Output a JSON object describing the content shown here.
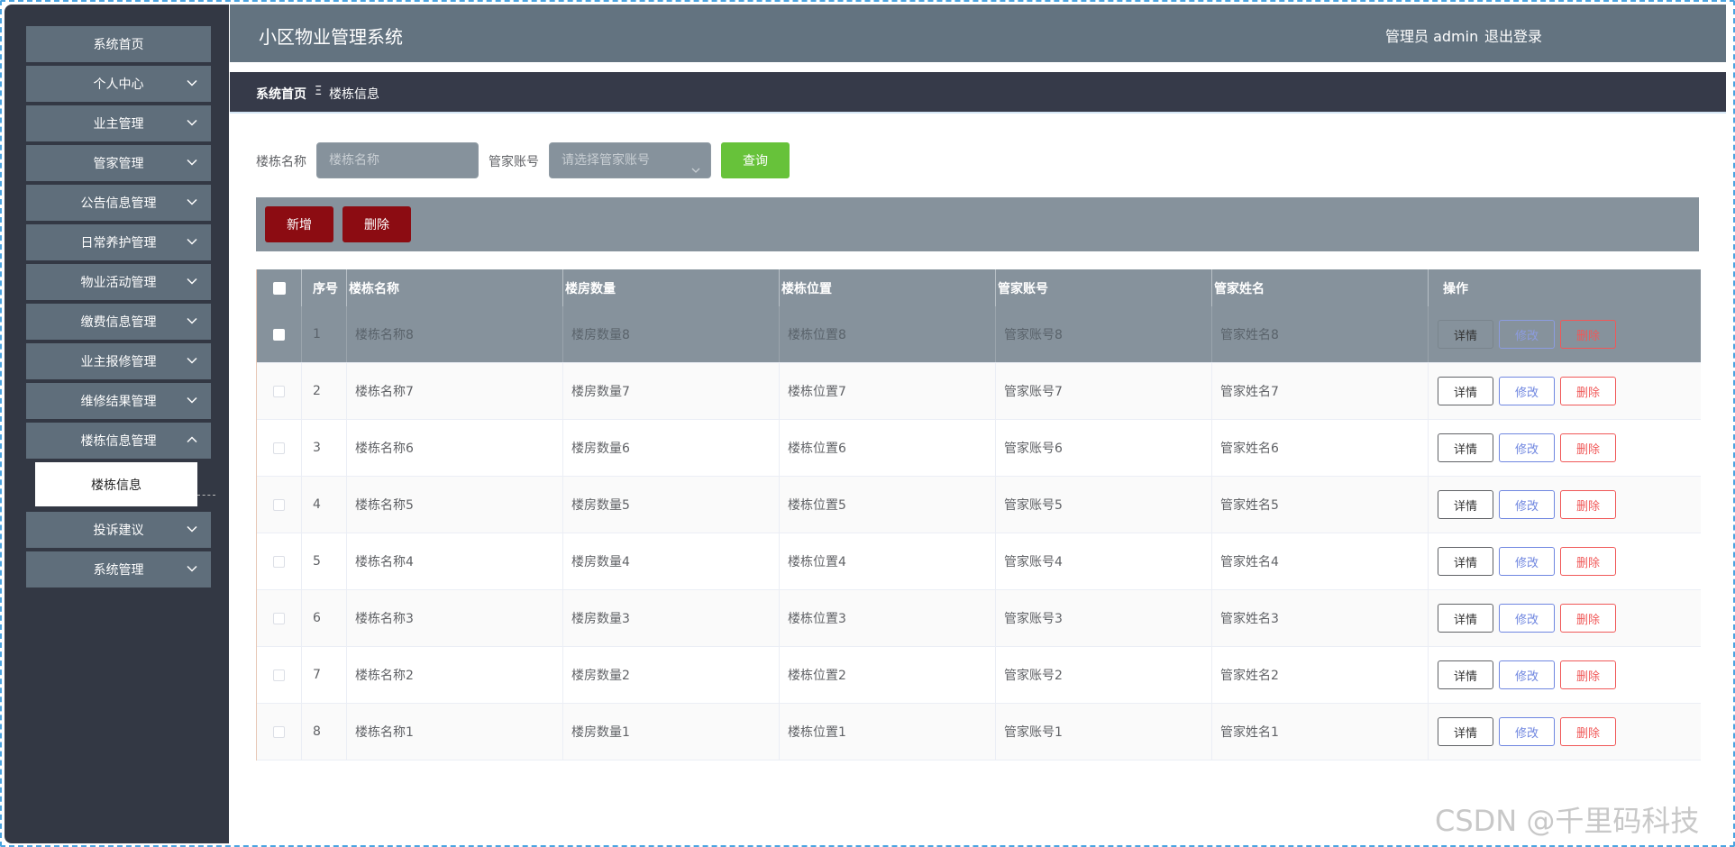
{
  "header": {
    "title": "小区物业管理系统",
    "user": "管理员 admin",
    "logout": "退出登录"
  },
  "sidebar": {
    "items": [
      {
        "label": "系统首页",
        "chevron": "none"
      },
      {
        "label": "个人中心",
        "chevron": "down"
      },
      {
        "label": "业主管理",
        "chevron": "down"
      },
      {
        "label": "管家管理",
        "chevron": "down"
      },
      {
        "label": "公告信息管理",
        "chevron": "down"
      },
      {
        "label": "日常养护管理",
        "chevron": "down"
      },
      {
        "label": "物业活动管理",
        "chevron": "down"
      },
      {
        "label": "缴费信息管理",
        "chevron": "down"
      },
      {
        "label": "业主报修管理",
        "chevron": "down"
      },
      {
        "label": "维修结果管理",
        "chevron": "down"
      },
      {
        "label": "楼栋信息管理",
        "chevron": "up"
      },
      {
        "label": "投诉建议",
        "chevron": "down"
      },
      {
        "label": "系统管理",
        "chevron": "down"
      }
    ],
    "submenu": {
      "label": "楼栋信息"
    }
  },
  "breadcrumb": {
    "home": "系统首页",
    "separator": "Ξ",
    "current": "楼栋信息"
  },
  "search": {
    "name_label": "楼栋名称",
    "name_placeholder": "楼栋名称",
    "account_label": "管家账号",
    "account_placeholder": "请选择管家账号",
    "query_button": "查询"
  },
  "toolbar": {
    "add_button": "新增",
    "delete_button": "删除"
  },
  "table": {
    "columns": [
      "",
      "序号",
      "楼栋名称",
      "楼房数量",
      "楼栋位置",
      "管家账号",
      "管家姓名",
      "操作"
    ],
    "rows": [
      {
        "index": "1",
        "name": "楼栋名称8",
        "count": "楼房数量8",
        "position": "楼栋位置8",
        "account": "管家账号8",
        "manager": "管家姓名8"
      },
      {
        "index": "2",
        "name": "楼栋名称7",
        "count": "楼房数量7",
        "position": "楼栋位置7",
        "account": "管家账号7",
        "manager": "管家姓名7"
      },
      {
        "index": "3",
        "name": "楼栋名称6",
        "count": "楼房数量6",
        "position": "楼栋位置6",
        "account": "管家账号6",
        "manager": "管家姓名6"
      },
      {
        "index": "4",
        "name": "楼栋名称5",
        "count": "楼房数量5",
        "position": "楼栋位置5",
        "account": "管家账号5",
        "manager": "管家姓名5"
      },
      {
        "index": "5",
        "name": "楼栋名称4",
        "count": "楼房数量4",
        "position": "楼栋位置4",
        "account": "管家账号4",
        "manager": "管家姓名4"
      },
      {
        "index": "6",
        "name": "楼栋名称3",
        "count": "楼房数量3",
        "position": "楼栋位置3",
        "account": "管家账号3",
        "manager": "管家姓名3"
      },
      {
        "index": "7",
        "name": "楼栋名称2",
        "count": "楼房数量2",
        "position": "楼栋位置2",
        "account": "管家账号2",
        "manager": "管家姓名2"
      },
      {
        "index": "8",
        "name": "楼栋名称1",
        "count": "楼房数量1",
        "position": "楼栋位置1",
        "account": "管家账号1",
        "manager": "管家姓名1"
      }
    ],
    "actions": {
      "detail": "详情",
      "edit": "修改",
      "delete": "删除"
    }
  },
  "watermark": "CSDN @千里码科技",
  "colors": {
    "sidebar_bg": "#333844",
    "menu_item_bg": "#5f6e7b",
    "header_bg": "#637380",
    "breadcrumb_bg": "#363a49",
    "toolbar_bg": "#86929c",
    "query_button": "#67c23a",
    "danger_button": "#8c0c12",
    "edit_accent": "#6f86e0",
    "delete_accent": "#f05858"
  }
}
